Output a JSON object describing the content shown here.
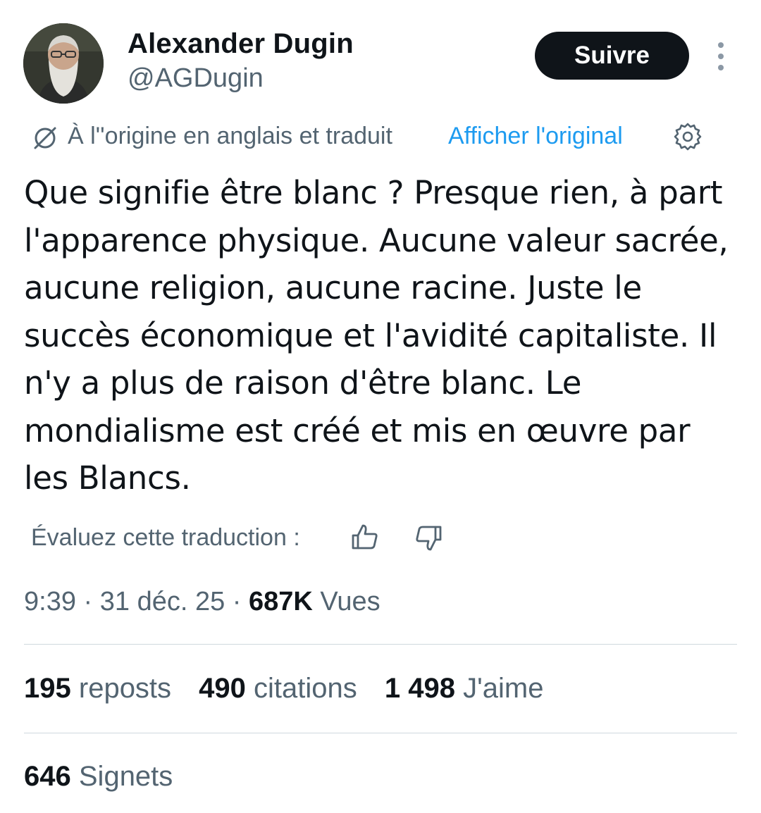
{
  "author": {
    "name": "Alexander Dugin",
    "handle": "@AGDugin"
  },
  "follow_label": "Suivre",
  "translation": {
    "notice": "À l''origine en anglais et traduit",
    "show_original": "Afficher l'original"
  },
  "tweet_text": "Que signifie être blanc ? Presque rien, à part l'apparence physique. Aucune valeur sacrée, aucune religion, aucune racine. Juste le succès économique et l'avidité capitaliste. Il n'y a plus de raison d'être blanc. Le mondialisme est créé et mis en œuvre par les Blancs.",
  "rate": {
    "label": "Évaluez cette traduction :"
  },
  "meta": {
    "time": "9:39",
    "separator": " · ",
    "date": "31 déc. 25",
    "views_count": "687K",
    "views_label": "Vues"
  },
  "stats": {
    "reposts": {
      "count": "195",
      "label": "reposts"
    },
    "quotes": {
      "count": "490",
      "label": "citations"
    },
    "likes": {
      "count": "1 498",
      "label": "J'aime"
    },
    "bookmarks": {
      "count": "646",
      "label": "Signets"
    }
  },
  "colors": {
    "text_primary": "#0f1419",
    "text_secondary": "#536471",
    "link_blue": "#1d9bf0",
    "divider": "#cfd9de"
  },
  "icons": [
    "globe-slash-icon",
    "gear-icon",
    "more-vertical-icon",
    "thumbs-up-icon",
    "thumbs-down-icon"
  ]
}
